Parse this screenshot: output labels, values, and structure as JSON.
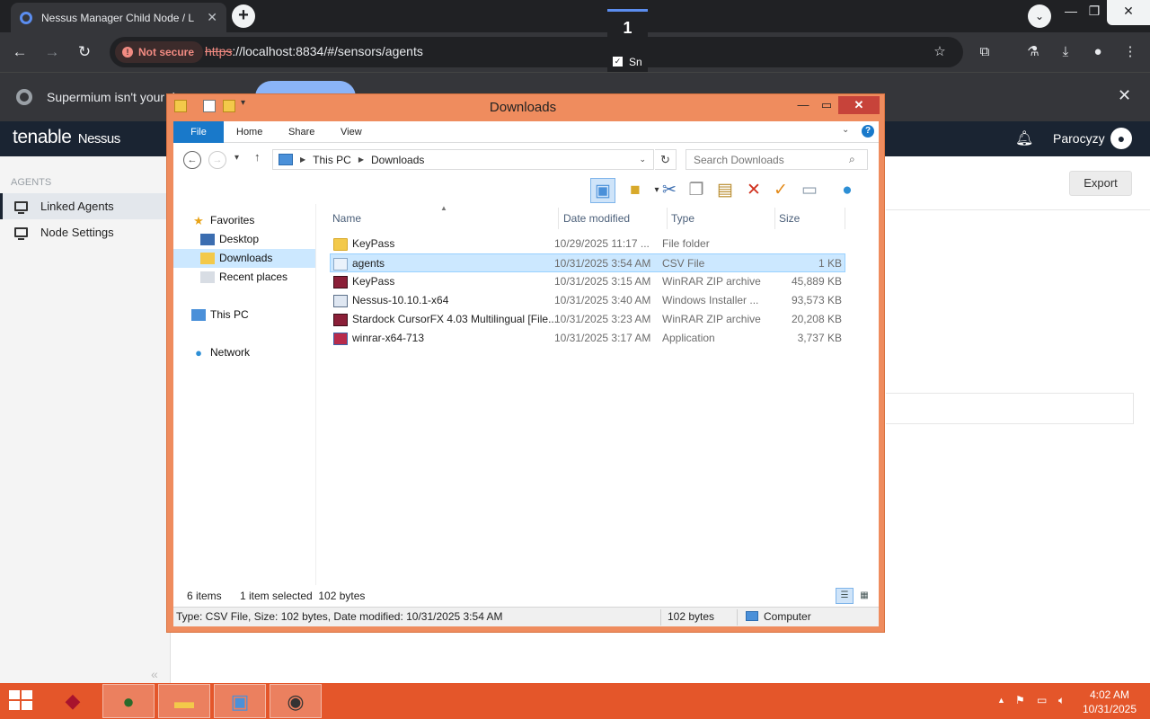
{
  "browser": {
    "tab_title": "Nessus Manager Child Node / L",
    "tab_close": "✕",
    "new_tab": "+",
    "url_scheme": "https",
    "url_rest": "://localhost:8834/#/sensors/agents",
    "not_secure": "Not secure",
    "zoom_popup": {
      "number": "1",
      "label": "Sn"
    },
    "infobar_text": "Supermium isn't your d",
    "infobar_button": "",
    "icons": [
      "back-icon",
      "forward-icon",
      "reload-icon",
      "star-icon",
      "extensions-icon",
      "labs-icon",
      "download-icon",
      "profile-icon",
      "menu-icon"
    ]
  },
  "nessus": {
    "logo_brand": "tenable",
    "logo_product": "Nessus",
    "user": "Parocyzy",
    "sidebar_heading": "AGENTS",
    "sidebar_items": [
      {
        "label": "Linked Agents",
        "active": true
      },
      {
        "label": "Node Settings",
        "active": false
      }
    ],
    "export_label": "Export"
  },
  "explorer": {
    "title": "Downloads",
    "ribbon_tabs": [
      "File",
      "Home",
      "Share",
      "View"
    ],
    "breadcrumb": [
      "This PC",
      "Downloads"
    ],
    "search_placeholder": "Search Downloads",
    "nav": {
      "favorites": "Favorites",
      "favorite_items": [
        "Desktop",
        "Downloads",
        "Recent places"
      ],
      "this_pc": "This PC",
      "network": "Network",
      "selected": "Downloads"
    },
    "columns": [
      "Name",
      "Date modified",
      "Type",
      "Size"
    ],
    "files": [
      {
        "name": "KeyPass",
        "date": "10/29/2025 11:17 ...",
        "type": "File folder",
        "size": "",
        "icon": "folder-icon",
        "selected": false
      },
      {
        "name": "agents",
        "date": "10/31/2025 3:54 AM",
        "type": "CSV File",
        "size": "1 KB",
        "icon": "csv-file-icon",
        "selected": true
      },
      {
        "name": "KeyPass",
        "date": "10/31/2025 3:15 AM",
        "type": "WinRAR ZIP archive",
        "size": "45,889 KB",
        "icon": "winrar-archive-icon",
        "selected": false
      },
      {
        "name": "Nessus-10.10.1-x64",
        "date": "10/31/2025 3:40 AM",
        "type": "Windows Installer ...",
        "size": "93,573 KB",
        "icon": "installer-icon",
        "selected": false
      },
      {
        "name": "Stardock CursorFX 4.03 Multilingual [File...",
        "date": "10/31/2025 3:23 AM",
        "type": "WinRAR ZIP archive",
        "size": "20,208 KB",
        "icon": "winrar-archive-icon",
        "selected": false
      },
      {
        "name": "winrar-x64-713",
        "date": "10/31/2025 3:17 AM",
        "type": "Application",
        "size": "3,737 KB",
        "icon": "application-icon",
        "selected": false
      }
    ],
    "status_items": "6 items",
    "status_selected": "1 item selected  102 bytes",
    "details_info": "Type: CSV File, Size: 102 bytes, Date modified: 10/31/2025 3:54 AM",
    "details_size": "102 bytes",
    "details_location": "Computer"
  },
  "taskbar": {
    "time": "4:02 AM",
    "date": "10/31/2025",
    "apps": [
      "winrar-app-icon",
      "browser-app-icon",
      "file-explorer-app-icon",
      "control-panel-app-icon",
      "cursorfx-app-icon"
    ]
  }
}
